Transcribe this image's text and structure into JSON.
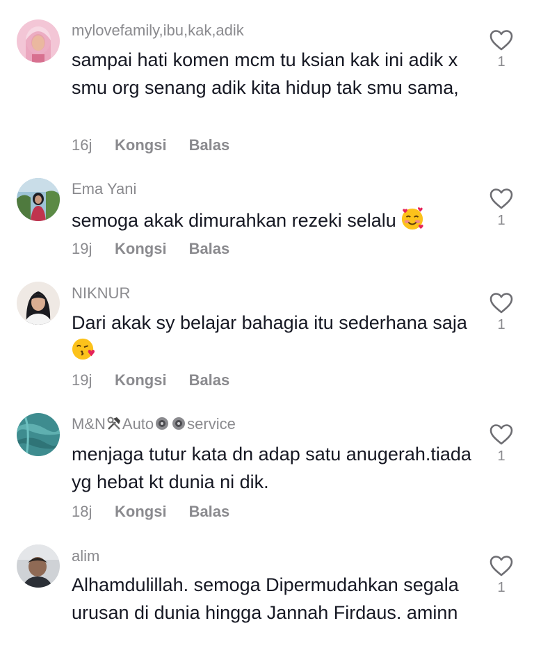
{
  "comments": [
    {
      "username": "mylovefamily,ibu,kak,adik",
      "text": "sampai hati komen mcm tu ksian kak ini adik x smu org senang adik kita hidup tak smu sama,",
      "time": "16j",
      "share_label": "Kongsi",
      "reply_label": "Balas",
      "likes": "1"
    },
    {
      "username": "Ema Yani",
      "text": "semoga akak dimurahkan rezeki selalu",
      "emoji": "smiling-face-with-hearts",
      "time": "19j",
      "share_label": "Kongsi",
      "reply_label": "Balas",
      "likes": "1"
    },
    {
      "username": "NIKNUR",
      "text": "Dari akak sy belajar bahagia itu sederhana saja",
      "emoji": "face-blowing-a-kiss",
      "time": "19j",
      "share_label": "Kongsi",
      "reply_label": "Balas",
      "likes": "1"
    },
    {
      "username_parts": [
        "M&N",
        "Auto",
        "service"
      ],
      "username_icons": [
        "hammer-and-wrench-icon",
        "gear-icon",
        "gear-icon"
      ],
      "text": "menjaga tutur kata dn adap satu anugerah.tiada yg hebat kt dunia ni dik.",
      "time": "18j",
      "share_label": "Kongsi",
      "reply_label": "Balas",
      "likes": "1"
    },
    {
      "username": "alim",
      "text": "Alhamdulillah. semoga Dipermudahkan segala urusan di dunia hingga Jannah Firdaus. aminn",
      "likes": "1"
    }
  ],
  "colors": {
    "text_primary": "#161823",
    "text_secondary": "#8a8a8e",
    "heart_outline": "#6e6e73",
    "background": "#ffffff"
  }
}
